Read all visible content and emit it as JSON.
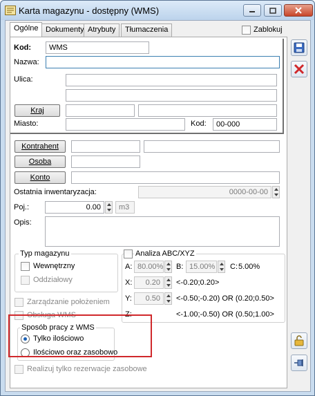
{
  "window": {
    "title": "Karta magazynu - dostępny (WMS)"
  },
  "tabs": [
    "Ogólne",
    "Dokumenty",
    "Atrybuty",
    "Tłumaczenia"
  ],
  "zablokuj_label": "Zablokuj",
  "fields": {
    "kod_label": "Kod:",
    "kod_value": "WMS",
    "nazwa_label": "Nazwa:",
    "nazwa_value": "",
    "ulica_label": "Ulica:",
    "kraj_button": "Kraj",
    "miasto_label": "Miasto:",
    "kod_pocztowy_label": "Kod:",
    "kod_pocztowy_value": "00-000",
    "kontrahent_button": "Kontrahent",
    "osoba_button": "Osoba",
    "konto_button": "Konto",
    "inwentaryzacja_label": "Ostatnia inwentaryzacja:",
    "inwentaryzacja_value": "0000-00-00",
    "poj_label": "Poj.:",
    "poj_value": "0.00",
    "poj_unit": "m3",
    "opis_label": "Opis:"
  },
  "typ_magazynu": {
    "title": "Typ magazynu",
    "options": [
      "Wewnętrzny",
      "Oddziałowy"
    ]
  },
  "abc": {
    "title": "Analiza ABC/XYZ",
    "a_label": "A:",
    "a_value": "80.00%",
    "b_label": "B:",
    "b_value": "15.00%",
    "c_label": "C:",
    "c_value": "5.00%",
    "x_label": "X:",
    "x_value": "0.20",
    "x_range": "<-0.20;0.20>",
    "y_label": "Y:",
    "y_value": "0.50",
    "y_range": "<-0.50;-0.20) OR (0.20;0.50>",
    "z_label": "Z:",
    "z_range": "<-1.00;-0.50) OR (0.50;1.00>"
  },
  "checkboxes": {
    "zarzadzanie": "Zarządzanie położeniem",
    "obsluga_wms": "Obsługa WMS",
    "realizuj": "Realizuj tylko rezerwacje zasobowe"
  },
  "sposob_pracy": {
    "title": "Sposób pracy z WMS",
    "options": [
      "Tylko ilościowo",
      "Ilościowo oraz zasobowo"
    ],
    "selected": 0
  },
  "colors": {
    "highlight_border": "#d0282b",
    "accent": "#1a5fb4"
  }
}
